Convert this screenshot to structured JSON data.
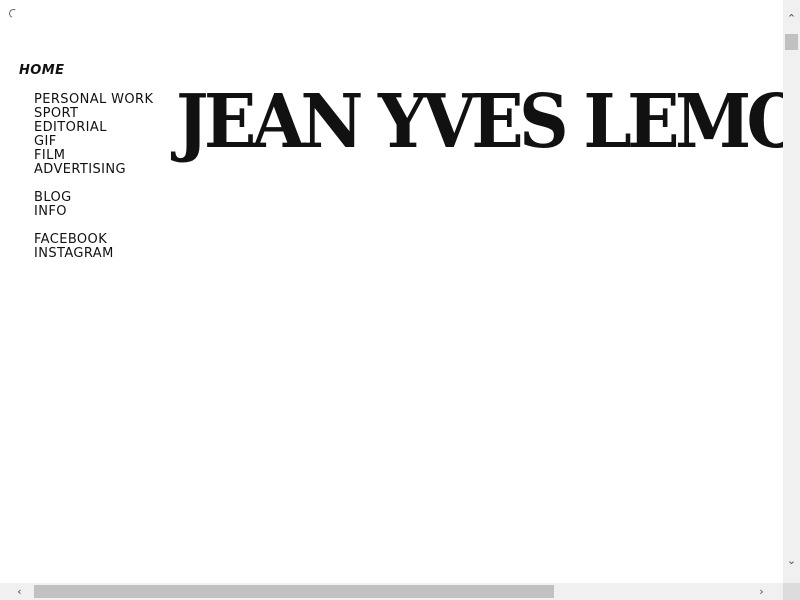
{
  "site": {
    "title": "JEAN YVES LEMOIGNE"
  },
  "nav": {
    "home": "HOME",
    "work": [
      "PERSONAL WORK",
      "SPORT",
      "EDITORIAL",
      "GIF",
      "FILM",
      "ADVERTISING"
    ],
    "pages": [
      "BLOG",
      "INFO"
    ],
    "social": [
      "FACEBOOK",
      "INSTAGRAM"
    ]
  },
  "icons": {
    "loading": "loading-spinner-icon",
    "scroll_up": "chevron-up-icon",
    "scroll_down": "chevron-down-icon",
    "scroll_left": "chevron-left-icon",
    "scroll_right": "chevron-right-icon"
  },
  "scroll": {
    "vertical_position": 0.0,
    "horizontal_position": 0.0
  },
  "colors": {
    "text": "#111111",
    "background": "#ffffff",
    "scrollbar_track": "#f0f0f0",
    "scrollbar_thumb": "#c1c1c1"
  }
}
